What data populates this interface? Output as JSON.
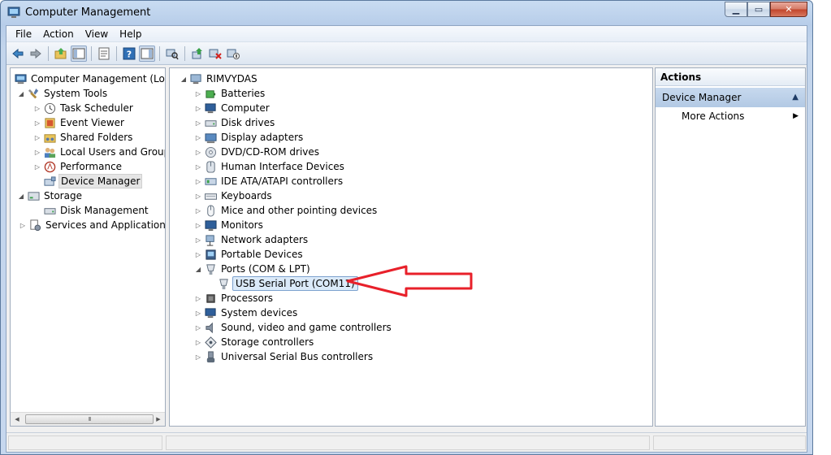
{
  "window": {
    "title": "Computer Management"
  },
  "menubar": {
    "items": [
      "File",
      "Action",
      "View",
      "Help"
    ]
  },
  "toolbar": {
    "buttons": [
      "back-icon",
      "forward-icon",
      "up-folder-icon",
      "show-tree-icon",
      "properties-icon",
      "help-icon",
      "show-action-pane-icon",
      "scan-hardware-icon",
      "update-driver-icon",
      "uninstall-icon",
      "disable-icon"
    ]
  },
  "left_tree": {
    "root": "Computer Management (Local",
    "system_tools": "System Tools",
    "system_tools_children": [
      "Task Scheduler",
      "Event Viewer",
      "Shared Folders",
      "Local Users and Groups",
      "Performance",
      "Device Manager"
    ],
    "storage": "Storage",
    "storage_children": [
      "Disk Management"
    ],
    "services": "Services and Applications",
    "scroll_grip": "III"
  },
  "device_tree": {
    "computer_name": "RIMVYDAS",
    "categories": [
      "Batteries",
      "Computer",
      "Disk drives",
      "Display adapters",
      "DVD/CD-ROM drives",
      "Human Interface Devices",
      "IDE ATA/ATAPI controllers",
      "Keyboards",
      "Mice and other pointing devices",
      "Monitors",
      "Network adapters",
      "Portable Devices",
      "Ports (COM & LPT)"
    ],
    "ports_child": "USB Serial Port (COM11)",
    "categories_after": [
      "Processors",
      "System devices",
      "Sound, video and game controllers",
      "Storage controllers",
      "Universal Serial Bus controllers"
    ]
  },
  "actions": {
    "header": "Actions",
    "section": "Device Manager",
    "link": "More Actions"
  },
  "colors": {
    "annotation_arrow": "#e8202a",
    "selection_blue": "#dbeaf9",
    "title_gradient": "#c9dcf2"
  }
}
